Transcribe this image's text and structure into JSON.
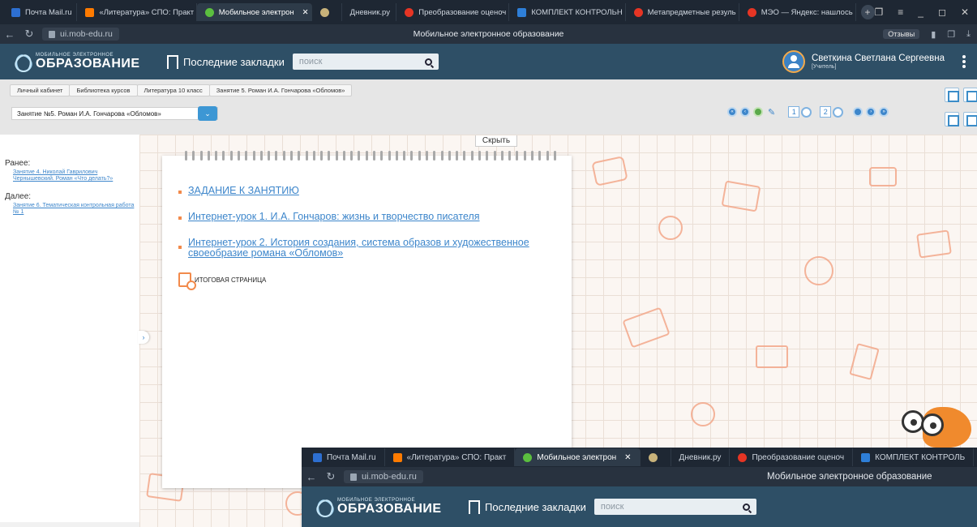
{
  "browser": {
    "tabs": [
      {
        "label": "Почта Mail.ru",
        "icon": "mail-icon",
        "active": false
      },
      {
        "label": "«Литература» СПО: Практ",
        "icon": "in-icon",
        "active": false
      },
      {
        "label": "Мобильное электрон",
        "icon": "moe-icon",
        "active": true
      },
      {
        "label": "",
        "icon": "bird-icon",
        "active": false
      },
      {
        "label": "Дневник.ру",
        "icon": "dnevnik-icon",
        "active": false
      },
      {
        "label": "Преобразование оценоч",
        "icon": "yandex-icon",
        "active": false
      },
      {
        "label": "КОМПЛЕКТ КОНТРОЛЬН",
        "icon": "doc-icon",
        "active": false
      },
      {
        "label": "Метапредметные резуль",
        "icon": "yandex-icon",
        "active": false
      },
      {
        "label": "МЭО — Яндекс: нашлось",
        "icon": "yandex-icon",
        "active": false
      }
    ],
    "url": "ui.mob-edu.ru",
    "page_title": "Мобильное электронное образование",
    "feedback_label": "Отзывы"
  },
  "site": {
    "logo_small": "МОБИЛЬНОЕ ЭЛЕКТРОННОЕ",
    "logo_big": "ОБРАЗОВАНИЕ",
    "bookmarks_label": "Последние закладки",
    "search_placeholder": "поиск",
    "user_name": "Светкина Светлана Сергеевна",
    "user_role": "[Учитель]"
  },
  "breadcrumbs": [
    "Личный кабинет",
    "Библиотека курсов",
    "Литература 10 класс",
    "Занятие 5. Роман И.А. Гончарова «Обломов»"
  ],
  "lesson_select": {
    "value": "Занятие №5. Роман И.А. Гончарова «Обломов»"
  },
  "pager": {
    "pages": [
      "1",
      "2"
    ]
  },
  "hide_button": "Скрыть",
  "sidebar": {
    "prev_label": "Ранее:",
    "prev_link": "Занятие 4. Николай Гаврилович Чернышевский. Роман «Что делать?»",
    "next_label": "Далее:",
    "next_link": "Занятие 6. Тематическая контрольная работа № 1"
  },
  "tasks": [
    "ЗАДАНИЕ К ЗАНЯТИЮ",
    "Интернет-урок 1. И.А. Гончаров: жизнь и творчество писателя",
    "Интернет-урок 2. История создания, система образов и художественное своеобразие романа «Обломов»"
  ],
  "final_page": "ИТОГОВАЯ СТРАНИЦА",
  "overlay": {
    "tabs": [
      "Почта Mail.ru",
      "«Литература» СПО: Практ",
      "Мобильное электрон",
      "",
      "Дневник.ру",
      "Преобразование оценоч",
      "КОМПЛЕКТ КОНТРОЛЬ"
    ],
    "url": "ui.mob-edu.ru",
    "page_title": "Мобильное электронное образование",
    "logo_small": "МОБИЛЬНОЕ ЭЛЕКТРОННОЕ",
    "logo_big": "ОБРАЗОВАНИЕ",
    "bookmarks_label": "Последние закладки",
    "search_placeholder": "поиск"
  }
}
